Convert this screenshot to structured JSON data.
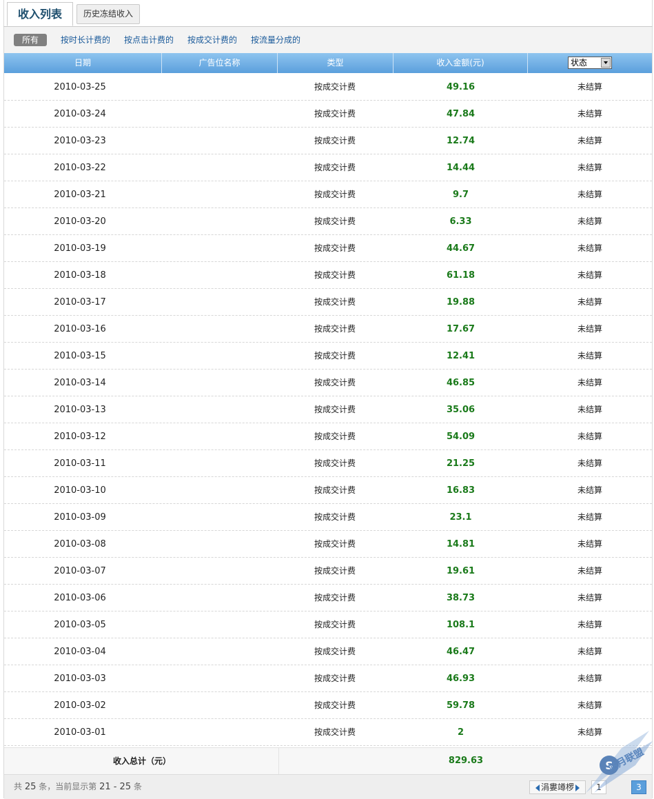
{
  "tabs": {
    "active": "收入列表",
    "inactive": "历史冻结收入"
  },
  "filters": {
    "all": "所有",
    "links": [
      "按时长计费的",
      "按点击计费的",
      "按成交计费的",
      "按流量分成的"
    ]
  },
  "table": {
    "headers": {
      "date": "日期",
      "ad_name": "广告位名称",
      "type": "类型",
      "amount": "收入金额(元)",
      "status": "状态"
    },
    "rows": [
      {
        "date": "2010-03-25",
        "type": "按成交计费",
        "amount": "49.16",
        "status": "未结算"
      },
      {
        "date": "2010-03-24",
        "type": "按成交计费",
        "amount": "47.84",
        "status": "未结算"
      },
      {
        "date": "2010-03-23",
        "type": "按成交计费",
        "amount": "12.74",
        "status": "未结算"
      },
      {
        "date": "2010-03-22",
        "type": "按成交计费",
        "amount": "14.44",
        "status": "未结算"
      },
      {
        "date": "2010-03-21",
        "type": "按成交计费",
        "amount": "9.7",
        "status": "未结算"
      },
      {
        "date": "2010-03-20",
        "type": "按成交计费",
        "amount": "6.33",
        "status": "未结算"
      },
      {
        "date": "2010-03-19",
        "type": "按成交计费",
        "amount": "44.67",
        "status": "未结算"
      },
      {
        "date": "2010-03-18",
        "type": "按成交计费",
        "amount": "61.18",
        "status": "未结算"
      },
      {
        "date": "2010-03-17",
        "type": "按成交计费",
        "amount": "19.88",
        "status": "未结算"
      },
      {
        "date": "2010-03-16",
        "type": "按成交计费",
        "amount": "17.67",
        "status": "未结算"
      },
      {
        "date": "2010-03-15",
        "type": "按成交计费",
        "amount": "12.41",
        "status": "未结算"
      },
      {
        "date": "2010-03-14",
        "type": "按成交计费",
        "amount": "46.85",
        "status": "未结算"
      },
      {
        "date": "2010-03-13",
        "type": "按成交计费",
        "amount": "35.06",
        "status": "未结算"
      },
      {
        "date": "2010-03-12",
        "type": "按成交计费",
        "amount": "54.09",
        "status": "未结算"
      },
      {
        "date": "2010-03-11",
        "type": "按成交计费",
        "amount": "21.25",
        "status": "未结算"
      },
      {
        "date": "2010-03-10",
        "type": "按成交计费",
        "amount": "16.83",
        "status": "未结算"
      },
      {
        "date": "2010-03-09",
        "type": "按成交计费",
        "amount": "23.1",
        "status": "未结算"
      },
      {
        "date": "2010-03-08",
        "type": "按成交计费",
        "amount": "14.81",
        "status": "未结算"
      },
      {
        "date": "2010-03-07",
        "type": "按成交计费",
        "amount": "19.61",
        "status": "未结算"
      },
      {
        "date": "2010-03-06",
        "type": "按成交计费",
        "amount": "38.73",
        "status": "未结算"
      },
      {
        "date": "2010-03-05",
        "type": "按成交计费",
        "amount": "108.1",
        "status": "未结算"
      },
      {
        "date": "2010-03-04",
        "type": "按成交计费",
        "amount": "46.47",
        "status": "未结算"
      },
      {
        "date": "2010-03-03",
        "type": "按成交计费",
        "amount": "46.93",
        "status": "未结算"
      },
      {
        "date": "2010-03-02",
        "type": "按成交计费",
        "amount": "59.78",
        "status": "未结算"
      },
      {
        "date": "2010-03-01",
        "type": "按成交计费",
        "amount": "2",
        "status": "未结算"
      }
    ],
    "total_label": "收入总计（元）",
    "total_amount": "829.63"
  },
  "footer": {
    "prefix": "共",
    "total_count": "25",
    "middle": "条，当前显示第",
    "range": "21 - 25",
    "suffix": "条",
    "prev_label": "涓婁竴椤",
    "pages": [
      "1",
      "3"
    ]
  },
  "watermark": {
    "text": "站月联盟"
  },
  "colors": {
    "header_blue": "#5b9fdc",
    "amount_green": "#1a7a1a",
    "link_blue": "#1a5a9a"
  }
}
